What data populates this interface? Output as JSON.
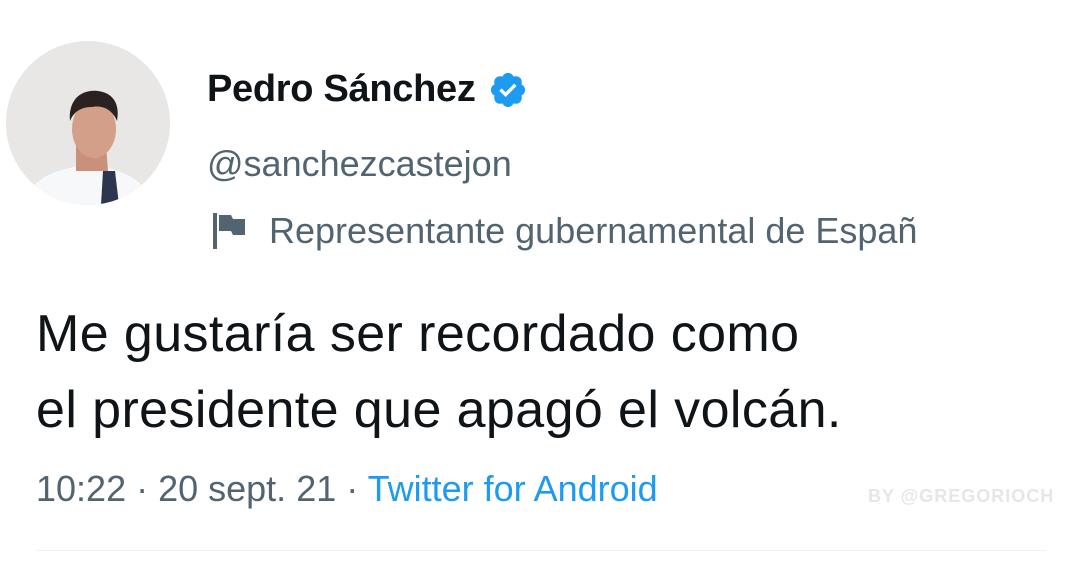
{
  "author": {
    "display_name": "Pedro Sánchez",
    "handle": "@sanchezcastejon",
    "label": "Representante gubernamental de Españ",
    "avatar_icon": "profile-photo",
    "verified_icon": "verified-badge-icon",
    "label_icon": "flag-icon"
  },
  "tweet": {
    "line1": "Me gustaría ser recordado como",
    "line2": "el presidente que apagó el volcán."
  },
  "meta": {
    "time": "10:22",
    "separator": " · ",
    "date": "20 sept. 21",
    "source": "Twitter for Android"
  },
  "watermark": "BY @GREGORIOCH",
  "colors": {
    "text": "#0f1419",
    "secondary": "#536471",
    "accent": "#1d9bf0"
  }
}
